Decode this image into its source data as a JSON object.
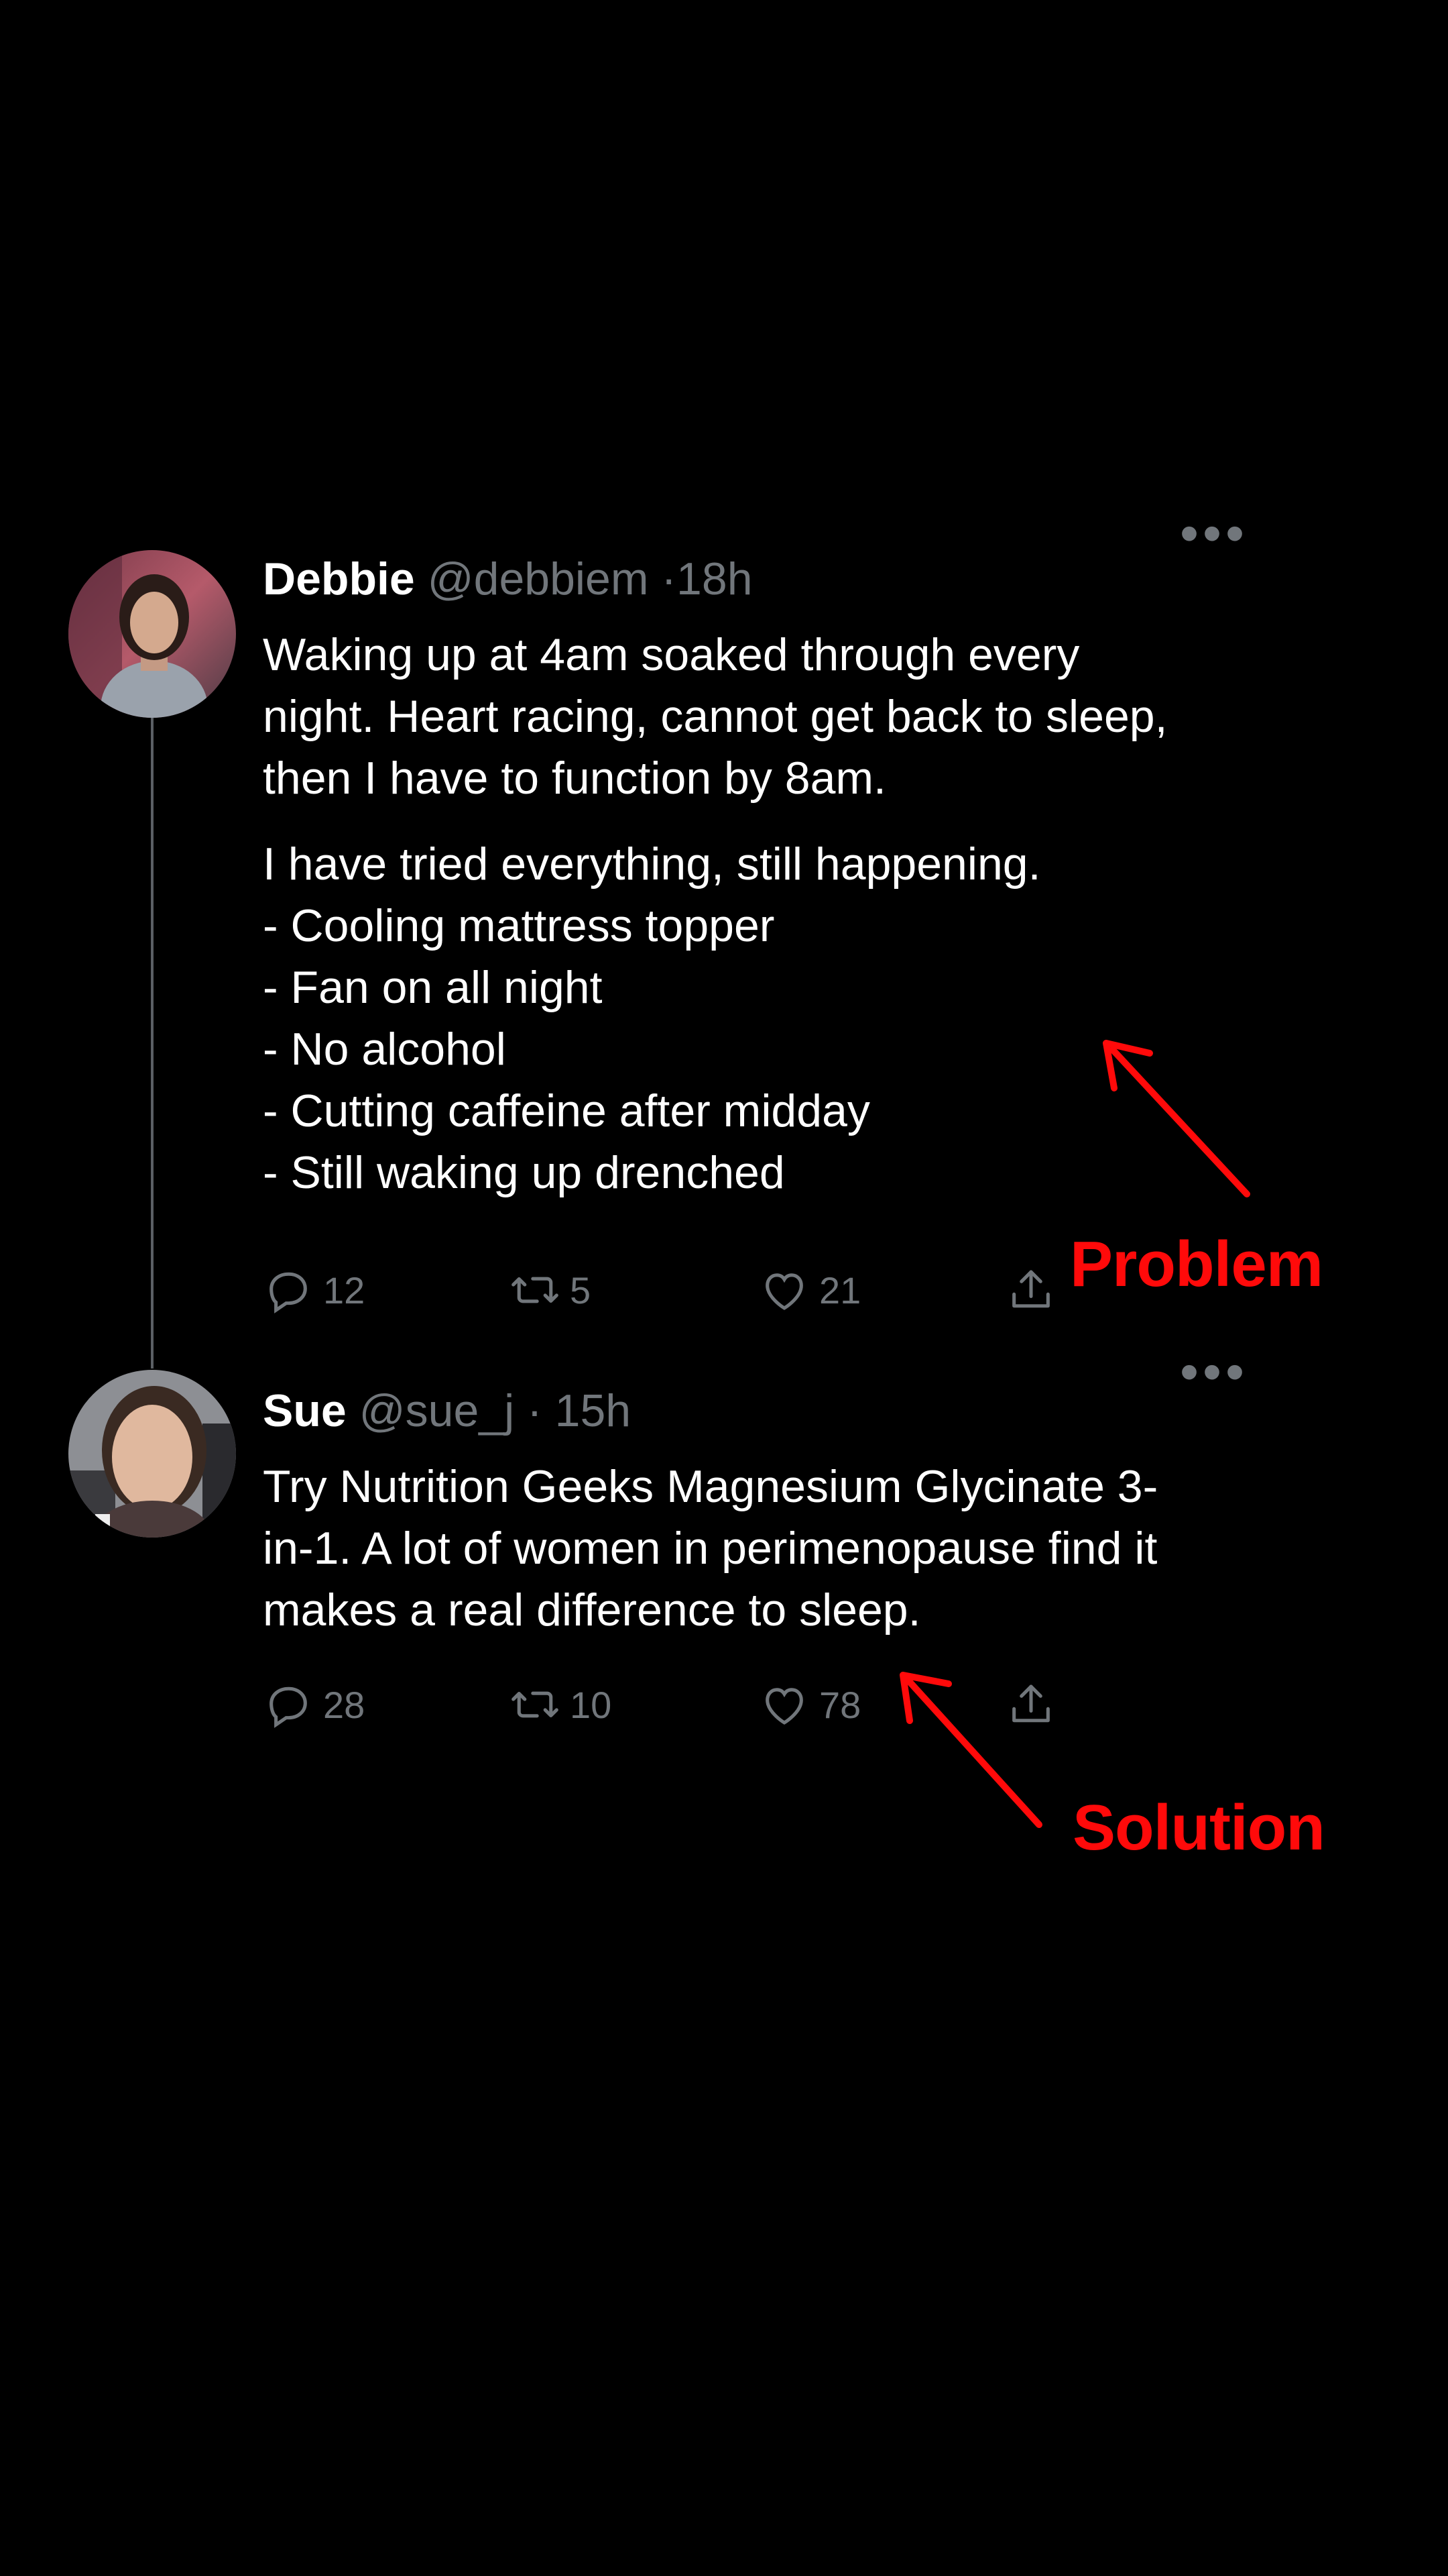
{
  "tweets": [
    {
      "name": "Debbie",
      "handle": "@debbiem",
      "time": "·18h",
      "paragraph1": "Waking up at 4am soaked through every night. Heart racing, cannot get back to sleep, then I have to function by 8am.",
      "paragraph2_lines": [
        "I have tried everything, still happening.",
        "- Cooling mattress topper",
        "- Fan on all night",
        "- No alcohol",
        "- Cutting caffeine after midday",
        "- Still waking up drenched"
      ],
      "replies": "12",
      "retweets": "5",
      "likes": "21",
      "more_label": "•••"
    },
    {
      "name": "Sue",
      "handle": "@sue_j",
      "time": "· 15h",
      "paragraph1": "Try Nutrition Geeks Magnesium Glycinate 3-in-1. A lot of women in perimenopause find it makes a real difference to sleep.",
      "replies": "28",
      "retweets": "10",
      "likes": "78",
      "more_label": "•••"
    }
  ],
  "annotations": {
    "problem": "Problem",
    "solution": "Solution",
    "color": "#ff0a0a"
  },
  "icons": {
    "reply": "reply-icon",
    "retweet": "retweet-icon",
    "like": "heart-icon",
    "share": "share-icon",
    "more": "more-icon"
  }
}
